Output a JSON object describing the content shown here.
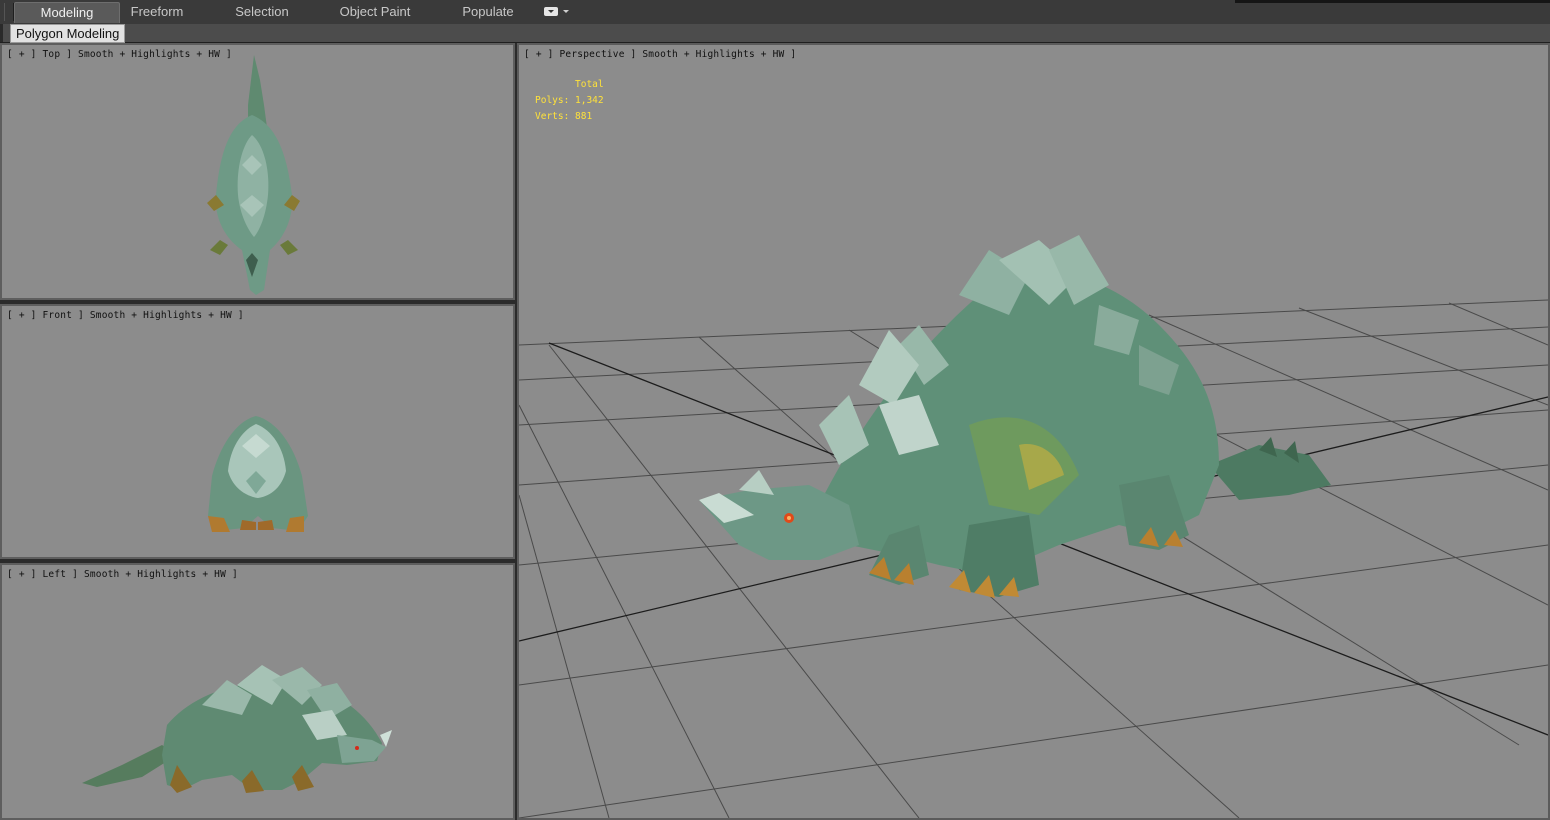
{
  "ribbon": {
    "tabs": [
      {
        "label": "Modeling",
        "active": true
      },
      {
        "label": "Freeform",
        "active": false
      },
      {
        "label": "Selection",
        "active": false
      },
      {
        "label": "Object Paint",
        "active": false
      },
      {
        "label": "Populate",
        "active": false
      }
    ],
    "panel_label": "Polygon Modeling"
  },
  "viewports": {
    "top": {
      "label": "[ + ] Top ] Smooth + Highlights + HW ]"
    },
    "front": {
      "label": "[ + ] Front ] Smooth + Highlights + HW ]"
    },
    "left": {
      "label": "[ + ] Left ] Smooth + Highlights + HW ]"
    },
    "perspective": {
      "label": "[ + ] Perspective ] Smooth + Highlights + HW ]",
      "stats": {
        "header": "Total",
        "polys_label": "Polys:",
        "polys": "1,342",
        "verts_label": "Verts:",
        "verts": "881"
      }
    }
  },
  "colors": {
    "viewport_bg": "#8c8c8c",
    "stats_text": "#ffe23a",
    "creature_body": "#5f8f7a",
    "creature_claws": "#b07a30"
  }
}
